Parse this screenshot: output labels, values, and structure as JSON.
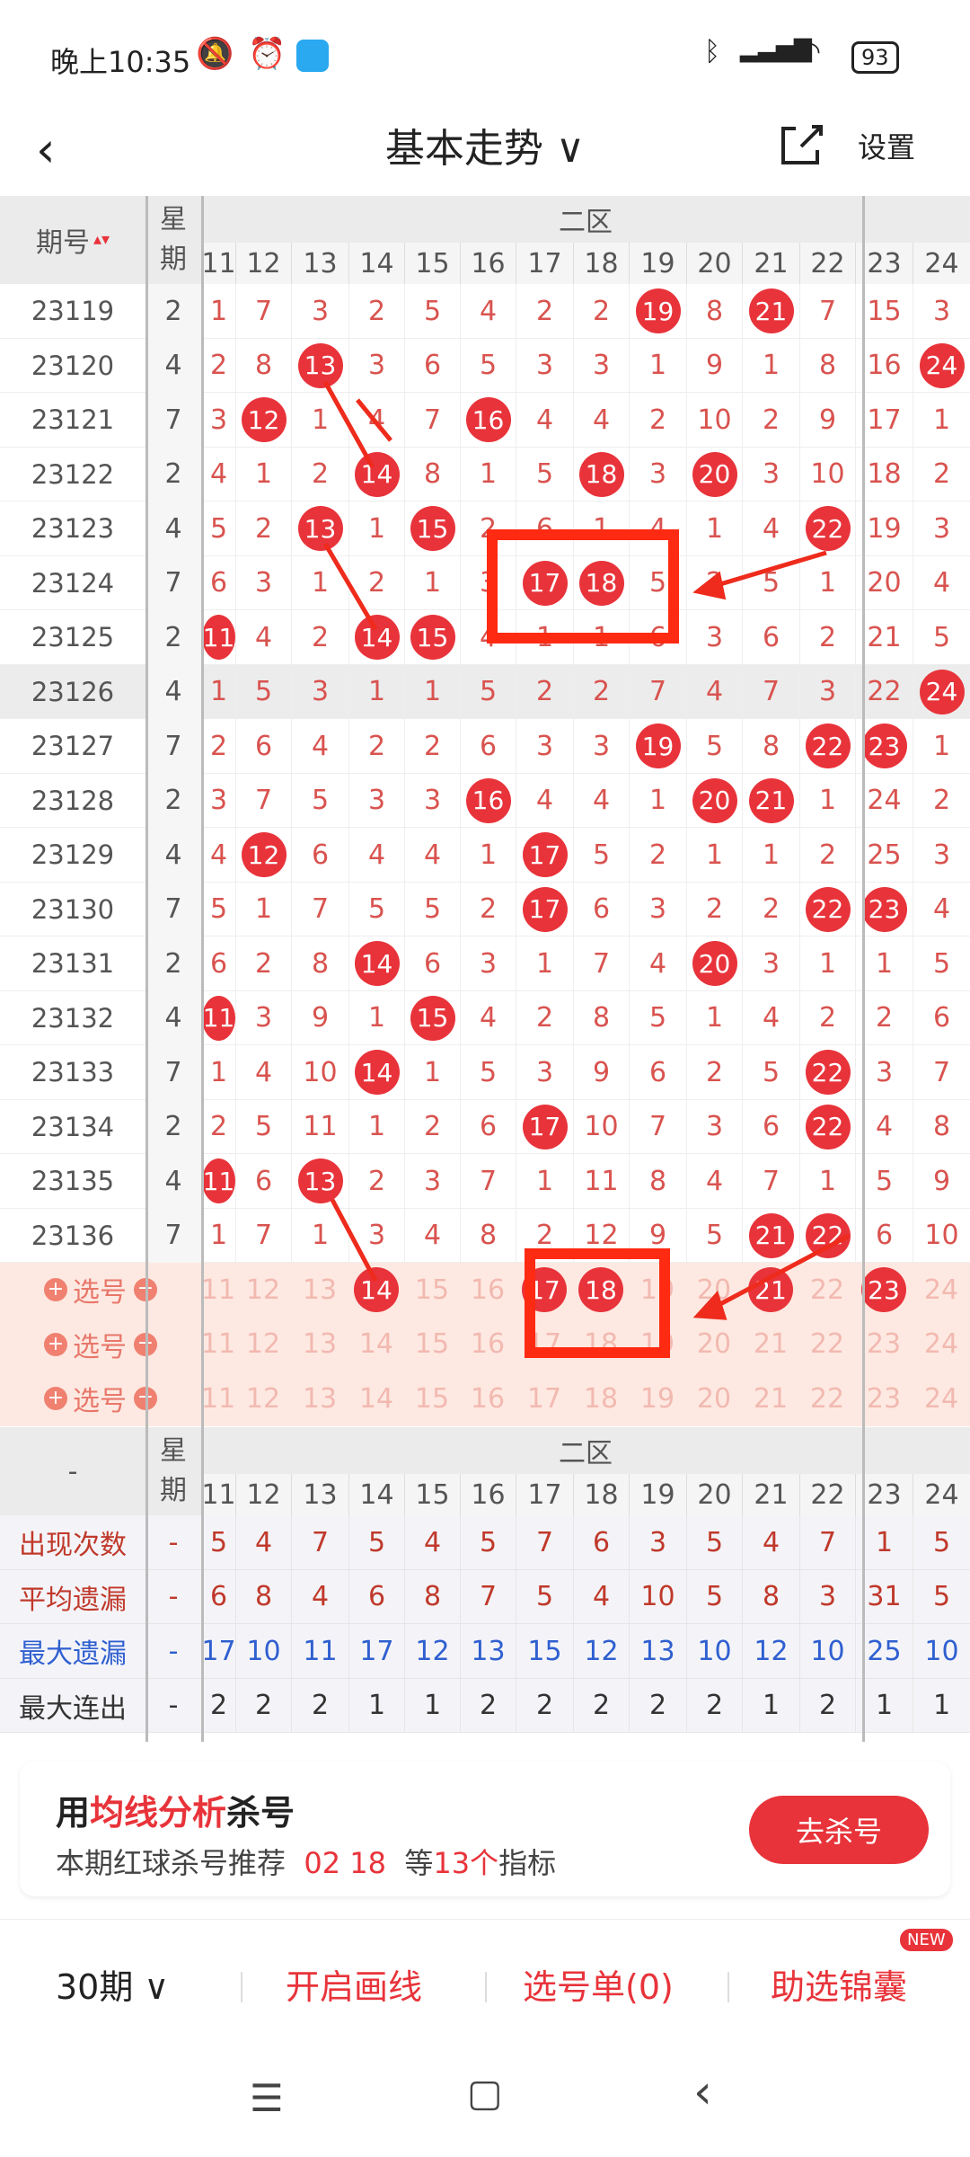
{
  "status": {
    "time": "晚上10:35",
    "battery": "93",
    "icons": [
      "mute-icon",
      "alarm-icon",
      "app-icon",
      "bluetooth-icon",
      "signal-icon",
      "wifi-icon",
      "battery-icon"
    ]
  },
  "topbar": {
    "back": "‹",
    "title": "基本走势 ∨",
    "settings": "设置"
  },
  "header": {
    "issue": "期号",
    "sort": "▴▾",
    "week": "星\n期",
    "zone": "二区",
    "cols": [
      "11",
      "12",
      "13",
      "14",
      "15",
      "16",
      "17",
      "18",
      "19",
      "20",
      "21",
      "22",
      "23",
      "24"
    ]
  },
  "rows": [
    {
      "issue": "23119",
      "week": "2",
      "cells": [
        "1",
        "7",
        "3",
        "2",
        "5",
        "4",
        "2",
        "2",
        "19",
        "8",
        "21",
        "7",
        "15",
        "3"
      ]
    },
    {
      "issue": "23120",
      "week": "4",
      "cells": [
        "2",
        "8",
        "13",
        "3",
        "6",
        "5",
        "3",
        "3",
        "1",
        "9",
        "1",
        "8",
        "16",
        "24"
      ]
    },
    {
      "issue": "23121",
      "week": "7",
      "cells": [
        "3",
        "12",
        "1",
        "4",
        "7",
        "16",
        "4",
        "4",
        "2",
        "10",
        "2",
        "9",
        "17",
        "1"
      ]
    },
    {
      "issue": "23122",
      "week": "2",
      "cells": [
        "4",
        "1",
        "2",
        "14",
        "8",
        "1",
        "5",
        "18",
        "3",
        "20",
        "3",
        "10",
        "18",
        "2"
      ]
    },
    {
      "issue": "23123",
      "week": "4",
      "cells": [
        "5",
        "2",
        "13",
        "1",
        "15",
        "2",
        "6",
        "1",
        "4",
        "1",
        "4",
        "22",
        "19",
        "3"
      ]
    },
    {
      "issue": "23124",
      "week": "7",
      "cells": [
        "6",
        "3",
        "1",
        "2",
        "1",
        "3",
        "17",
        "18",
        "5",
        "2",
        "5",
        "1",
        "20",
        "4"
      ]
    },
    {
      "issue": "23125",
      "week": "2",
      "cells": [
        "11",
        "4",
        "2",
        "14",
        "15",
        "4",
        "1",
        "1",
        "6",
        "3",
        "6",
        "2",
        "21",
        "5"
      ]
    },
    {
      "issue": "23126",
      "week": "4",
      "cells": [
        "1",
        "5",
        "3",
        "1",
        "1",
        "5",
        "2",
        "2",
        "7",
        "4",
        "7",
        "3",
        "22",
        "24"
      ]
    },
    {
      "issue": "23127",
      "week": "7",
      "cells": [
        "2",
        "6",
        "4",
        "2",
        "2",
        "6",
        "3",
        "3",
        "19",
        "5",
        "8",
        "22",
        "23",
        "1"
      ]
    },
    {
      "issue": "23128",
      "week": "2",
      "cells": [
        "3",
        "7",
        "5",
        "3",
        "3",
        "16",
        "4",
        "4",
        "1",
        "20",
        "21",
        "1",
        "24",
        "2"
      ]
    },
    {
      "issue": "23129",
      "week": "4",
      "cells": [
        "4",
        "12",
        "6",
        "4",
        "4",
        "1",
        "17",
        "5",
        "2",
        "1",
        "1",
        "2",
        "25",
        "3"
      ]
    },
    {
      "issue": "23130",
      "week": "7",
      "cells": [
        "5",
        "1",
        "7",
        "5",
        "5",
        "2",
        "17",
        "6",
        "3",
        "2",
        "2",
        "22",
        "23",
        "4"
      ]
    },
    {
      "issue": "23131",
      "week": "2",
      "cells": [
        "6",
        "2",
        "8",
        "14",
        "6",
        "3",
        "1",
        "7",
        "4",
        "20",
        "3",
        "1",
        "1",
        "5"
      ]
    },
    {
      "issue": "23132",
      "week": "4",
      "cells": [
        "11",
        "3",
        "9",
        "1",
        "15",
        "4",
        "2",
        "8",
        "5",
        "1",
        "4",
        "2",
        "2",
        "6"
      ]
    },
    {
      "issue": "23133",
      "week": "7",
      "cells": [
        "1",
        "4",
        "10",
        "14",
        "1",
        "5",
        "3",
        "9",
        "6",
        "2",
        "5",
        "22",
        "3",
        "7"
      ]
    },
    {
      "issue": "23134",
      "week": "2",
      "cells": [
        "2",
        "5",
        "11",
        "1",
        "2",
        "6",
        "17",
        "10",
        "7",
        "3",
        "6",
        "22",
        "4",
        "8"
      ]
    },
    {
      "issue": "23135",
      "week": "4",
      "cells": [
        "11",
        "6",
        "13",
        "2",
        "3",
        "7",
        "1",
        "11",
        "8",
        "4",
        "7",
        "1",
        "5",
        "9"
      ]
    },
    {
      "issue": "23136",
      "week": "7",
      "cells": [
        "1",
        "7",
        "1",
        "3",
        "4",
        "8",
        "2",
        "12",
        "9",
        "5",
        "21",
        "22",
        "6",
        "10"
      ]
    }
  ],
  "select_label": "选号",
  "select_rows": [
    [
      "11",
      "12",
      "13",
      "14",
      "15",
      "16",
      "17",
      "18",
      "19",
      "20",
      "21",
      "22",
      "23",
      "24"
    ],
    [
      "11",
      "12",
      "13",
      "14",
      "15",
      "16",
      "17",
      "18",
      "19",
      "20",
      "21",
      "22",
      "23",
      "24"
    ],
    [
      "11",
      "12",
      "13",
      "14",
      "15",
      "16",
      "17",
      "18",
      "19",
      "20",
      "21",
      "22",
      "23",
      "24"
    ]
  ],
  "stats_header": {
    "issue": "-",
    "week": "星\n期",
    "zone": "二区"
  },
  "stats": [
    {
      "label": "出现次数",
      "week": "-",
      "color": "#c0392b",
      "cells": [
        "5",
        "4",
        "7",
        "5",
        "4",
        "5",
        "7",
        "6",
        "3",
        "5",
        "4",
        "7",
        "1",
        "5"
      ]
    },
    {
      "label": "平均遗漏",
      "week": "-",
      "color": "#c0392b",
      "cells": [
        "6",
        "8",
        "4",
        "6",
        "8",
        "7",
        "5",
        "4",
        "10",
        "5",
        "8",
        "3",
        "31",
        "5"
      ]
    },
    {
      "label": "最大遗漏",
      "week": "-",
      "color": "#2f5fd0",
      "cells": [
        "17",
        "10",
        "11",
        "17",
        "12",
        "13",
        "15",
        "12",
        "13",
        "10",
        "12",
        "10",
        "25",
        "10"
      ]
    },
    {
      "label": "最大连出",
      "week": "-",
      "color": "#333333",
      "cells": [
        "2",
        "2",
        "2",
        "1",
        "1",
        "2",
        "2",
        "2",
        "2",
        "2",
        "1",
        "2",
        "1",
        "1"
      ]
    }
  ],
  "card": {
    "title_pre": "用",
    "title_red": "均线分析",
    "title_post": "杀号",
    "sub_pre": "本期红球杀号推荐",
    "sub_nums": "02 18",
    "sub_mid": "等",
    "sub_count": "13个",
    "sub_post": "指标",
    "button": "去杀号"
  },
  "bottom": {
    "periods": "30期 ∨",
    "draw": "开启画线",
    "list": "选号单(0)",
    "helper": "助选锦囊",
    "new": "NEW"
  },
  "nav": {
    "menu": "☰",
    "home": "▢",
    "back": "‹"
  }
}
